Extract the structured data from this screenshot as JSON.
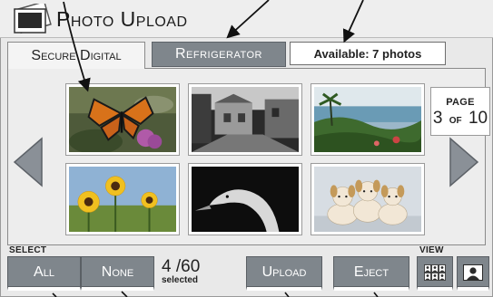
{
  "app": {
    "title": "Photo Upload",
    "icon": "photo-stack-icon"
  },
  "tabs": [
    {
      "label": "Secure Digital",
      "active": true
    },
    {
      "label": "Refrigerator",
      "active": false
    }
  ],
  "available": "Available: 7 photos",
  "pagination": {
    "label": "Page",
    "current": "3",
    "of": "of",
    "total": "10"
  },
  "photos": [
    {
      "subject": "monarch-butterfly"
    },
    {
      "subject": "village-street"
    },
    {
      "subject": "coastal-landscape"
    },
    {
      "subject": "sunflowers"
    },
    {
      "subject": "swan-head"
    },
    {
      "subject": "puppies"
    }
  ],
  "select": {
    "label": "Select",
    "all": "All",
    "none": "None",
    "count": "4 /60",
    "count_label": "selected"
  },
  "actions": {
    "upload": "Upload",
    "eject": "Eject"
  },
  "view": {
    "label": "View",
    "grid_icon": "grid-view-icon",
    "single_icon": "single-view-icon"
  },
  "colors": {
    "button": "#7f868c",
    "panel": "#ededed",
    "frame": "#e9e9e9"
  }
}
